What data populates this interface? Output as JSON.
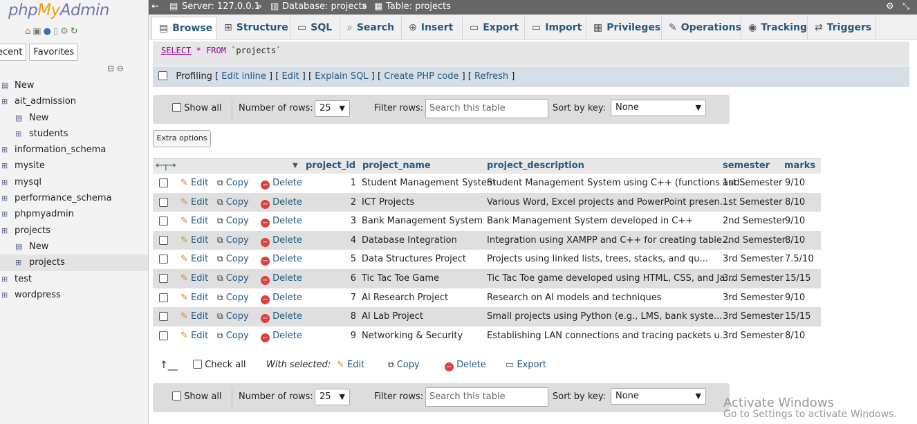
{
  "sidebar": {
    "logo": {
      "php": "php",
      "my": "My",
      "admin": "Admin"
    },
    "tabs": [
      "ecent",
      "Favorites"
    ],
    "tree": [
      {
        "label": "New",
        "indent": 0
      },
      {
        "label": "ait_admission",
        "indent": 0
      },
      {
        "label": "New",
        "indent": 1
      },
      {
        "label": "students",
        "indent": 1
      },
      {
        "label": "information_schema",
        "indent": 0
      },
      {
        "label": "mysite",
        "indent": 0
      },
      {
        "label": "mysql",
        "indent": 0
      },
      {
        "label": "performance_schema",
        "indent": 0
      },
      {
        "label": "phpmyadmin",
        "indent": 0
      },
      {
        "label": "projects",
        "indent": 0
      },
      {
        "label": "New",
        "indent": 1
      },
      {
        "label": "projects",
        "indent": 1,
        "selected": true
      },
      {
        "label": "test",
        "indent": 0
      },
      {
        "label": "wordpress",
        "indent": 0
      }
    ]
  },
  "breadcrumb": {
    "server": "Server: 127.0.0.1",
    "database": "Database: projects",
    "table": "Table: projects"
  },
  "tabs": [
    "Browse",
    "Structure",
    "SQL",
    "Search",
    "Insert",
    "Export",
    "Import",
    "Privileges",
    "Operations",
    "Tracking",
    "Triggers"
  ],
  "sql": {
    "select": "SELECT",
    "star": "*",
    "from": "FROM",
    "table": "`projects`"
  },
  "profiling": {
    "label": "Profiling",
    "links": [
      "Edit inline",
      "Edit",
      "Explain SQL",
      "Create PHP code",
      "Refresh"
    ]
  },
  "nav": {
    "show_all": "Show all",
    "num_rows_label": "Number of rows:",
    "num_rows_value": "25",
    "filter_label": "Filter rows:",
    "filter_placeholder": "Search this table",
    "sort_label": "Sort by key:",
    "sort_value": "None"
  },
  "extra_options": "Extra options",
  "columns": [
    "project_id",
    "project_name",
    "project_description",
    "semester",
    "marks"
  ],
  "actions": {
    "edit": "Edit",
    "copy": "Copy",
    "delete": "Delete"
  },
  "rows": [
    {
      "id": "1",
      "name": "Student Management System",
      "desc": "Student Management System using C++ (functions and...",
      "semester": "1st Semester",
      "marks": "9/10"
    },
    {
      "id": "2",
      "name": "ICT Projects",
      "desc": "Various Word, Excel projects and PowerPoint presen...",
      "semester": "1st Semester",
      "marks": "8/10"
    },
    {
      "id": "3",
      "name": "Bank Management System",
      "desc": "Bank Management System developed in C++",
      "semester": "2nd Semester",
      "marks": "9/10"
    },
    {
      "id": "4",
      "name": "Database Integration",
      "desc": "Integration using XAMPP and C++ for creating table...",
      "semester": "2nd Semester",
      "marks": "8/10"
    },
    {
      "id": "5",
      "name": "Data Structures Project",
      "desc": "Projects using linked lists, trees, stacks, and qu...",
      "semester": "3rd Semester",
      "marks": "7.5/10"
    },
    {
      "id": "6",
      "name": "Tic Tac Toe Game",
      "desc": "Tic Tac Toe game developed using HTML, CSS, and Ja...",
      "semester": "3rd Semester",
      "marks": "15/15"
    },
    {
      "id": "7",
      "name": "AI Research Project",
      "desc": "Research on AI models and techniques",
      "semester": "3rd Semester",
      "marks": "9/10"
    },
    {
      "id": "8",
      "name": "AI Lab Project",
      "desc": "Small projects using Python (e.g., LMS, bank syste...",
      "semester": "3rd Semester",
      "marks": "15/15"
    },
    {
      "id": "9",
      "name": "Networking & Security",
      "desc": "Establishing LAN connections and tracing packets u...",
      "semester": "3rd Semester",
      "marks": "8/10"
    }
  ],
  "bulk": {
    "check_all": "Check all",
    "with_selected": "With selected:",
    "edit": "Edit",
    "copy": "Copy",
    "delete": "Delete",
    "export": "Export"
  },
  "watermark": {
    "line1": "Activate Windows",
    "line2": "Go to Settings to activate Windows."
  }
}
